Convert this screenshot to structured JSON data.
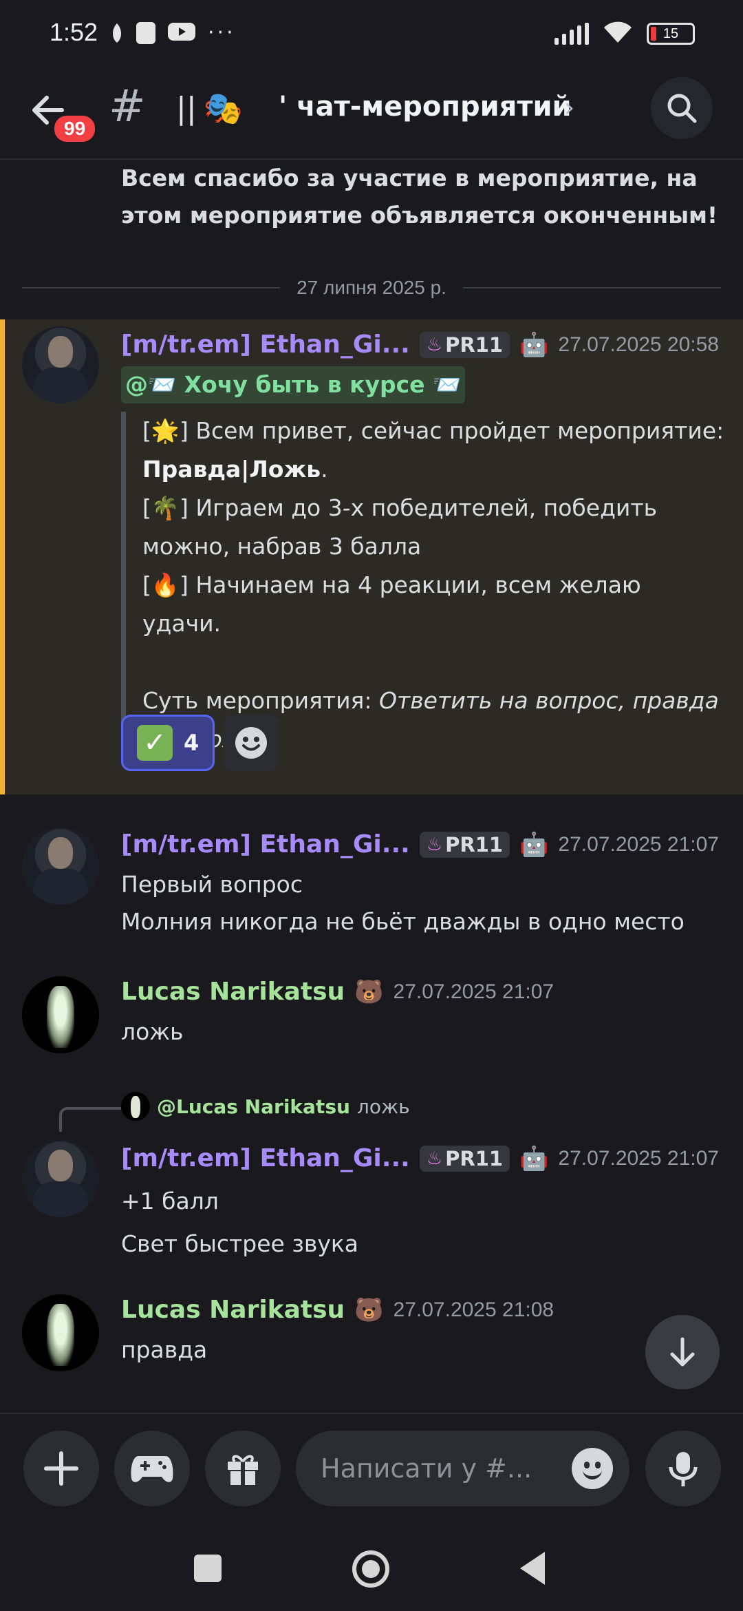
{
  "status_bar": {
    "time": "1:52",
    "battery": "15",
    "dots": "···"
  },
  "header": {
    "back_badge": "99",
    "hash": "#",
    "channel_prefix": "||",
    "channel_emoji": "🎭",
    "channel_name": "' чат-мероприятий",
    "chevron": "›"
  },
  "system_message": "Всем спасибо за участие в мероприятие, на этом мероприятие объявляется оконченным!",
  "date_divider": "27 липня 2025 р.",
  "messages": [
    {
      "author": "[m/tr.em] Ethan_Gi...",
      "tag": "PR11",
      "time": "27.07.2025 20:58",
      "mention": "@📨 Хочу быть в курсе 📨",
      "quote": {
        "line1_pre": "[",
        "line1_emoji": "🌟",
        "line1_post": "] Всем привет, сейчас пройдет мероприятие:",
        "line2_bold": "Правда|Ложь",
        "line2_post": ".",
        "line3_pre": "[",
        "line3_emoji": "🌴",
        "line3_post": "] Играем до 3-х победителей, победить можно, набрав 3 балла",
        "line4_pre": "[",
        "line4_emoji": "🔥",
        "line4_post": "] Начинаем на 4 реакции, всем желаю удачи.",
        "line5_pre": "Суть мероприятия: ",
        "line5_italic": "Ответить на вопрос, правда или ложь"
      },
      "reaction_count": "4"
    },
    {
      "author": "[m/tr.em] Ethan_Gi...",
      "tag": "PR11",
      "time": "27.07.2025 21:07",
      "line1": "Первый вопрос",
      "line2": "Молния никогда не бьёт дважды в одно место"
    },
    {
      "author": "Lucas Narikatsu",
      "time": "27.07.2025 21:07",
      "text": "ложь"
    },
    {
      "reply_to_name": "@Lucas Narikatsu",
      "reply_to_text": "ложь",
      "author": "[m/tr.em] Ethan_Gi...",
      "tag": "PR11",
      "time": "27.07.2025 21:07",
      "line1": "+1 балл",
      "line2": "Свет быстрее звука"
    },
    {
      "author": "Lucas Narikatsu",
      "time": "27.07.2025 21:08",
      "text": "правда"
    }
  ],
  "composer": {
    "placeholder": "Написати у #..."
  },
  "colors": {
    "accent": "#5865f2",
    "highlight_bar": "#f0b132",
    "username_purple": "#a78bfa",
    "username_green": "#a6e39b"
  }
}
